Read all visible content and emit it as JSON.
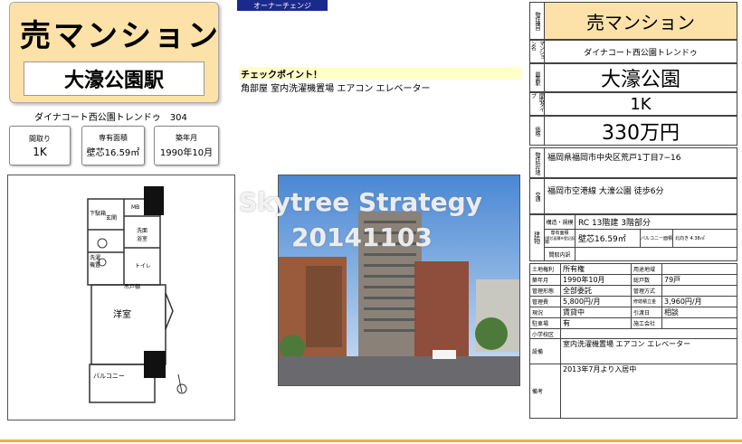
{
  "header": {
    "title": "売マンション",
    "station": "大濠公園駅",
    "building_room": "ダイナコート西公園トレンドゥ　304"
  },
  "info_boxes": [
    {
      "label": "間取り",
      "value": "1K"
    },
    {
      "label": "専有面積",
      "value": "壁芯16.59㎡"
    },
    {
      "label": "築年月",
      "value": "1990年10月"
    }
  ],
  "owner_badge": "オーナーチェンジ",
  "checkpoint": {
    "title": "チェックポイント！",
    "body": "角部屋 室内洗濯機置場 エアコン エレベーター"
  },
  "watermark": {
    "line1": "Skytree Strategy",
    "line2": "20141103"
  },
  "floorplan": {
    "labels": {
      "shoes": "下駄箱",
      "genkan": "玄関",
      "mb": "MB",
      "washroom": "洗面\n浴室",
      "laundry": "洗濯\n機置",
      "toilet": "トイレ",
      "closet": "吊戸棚",
      "room": "洋室",
      "balcony": "バルコニー"
    }
  },
  "table": {
    "type_label": "物件種目",
    "type_value": "売マンション",
    "name_label": "マンション名",
    "name_value": "ダイナコート西公園トレンドゥ",
    "station_label": "最寄駅",
    "station_value": "大濠公園",
    "layout_label": "間取タイプ",
    "layout_value": "1K",
    "price_label": "価格",
    "price_value": "330万円",
    "address_label": "物件所在地",
    "address_value": "福岡県福岡市中央区荒戸1丁目7−16",
    "transport_label": "交通",
    "transport_value": "福岡市空港線 大濠公園 徒歩6分",
    "building_label": "建物",
    "structure_label": "構造・規模",
    "structure_value": "RC 13階建 3階部分",
    "area_label": "専有面積",
    "area_sub": "(壁芯面積※登記面積)",
    "area_value": "壁芯16.59㎡",
    "balcony_label": "バルコニー面積",
    "balcony_value": "北向き 4.38㎡",
    "floorplan_label": "間取内訳",
    "rights_label": "土地権利",
    "rights_value": "所有権",
    "zoning_label": "用途地域",
    "built_label": "築年月",
    "built_value": "1990年10月",
    "units_label": "総戸数",
    "units_value": "79戸",
    "mgmt_form_label": "管理形態",
    "mgmt_form_value": "全部委託",
    "mgmt_method_label": "管理方式",
    "mgmt_fee_label": "管理費",
    "mgmt_fee_value": "5,800円/月",
    "repair_label": "修繕積立金",
    "repair_value": "3,960円/月",
    "status_label": "現況",
    "status_value": "賃貸中",
    "handover_label": "引渡日",
    "handover_value": "相談",
    "parking_label": "駐車場",
    "parking_value": "有",
    "builder_label": "施工会社",
    "elementary_label": "小学校区",
    "facilities_label": "設備",
    "facilities_value": "室内洗濯機置場 エアコン エレベーター",
    "remarks_label": "備考",
    "remarks_value": "2013年7月より入居中"
  }
}
